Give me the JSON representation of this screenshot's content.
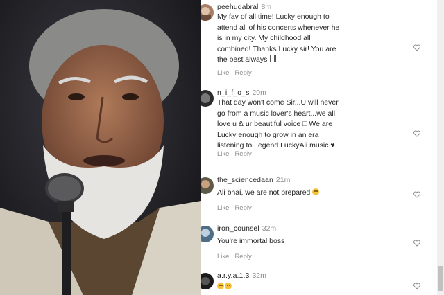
{
  "comments": [
    {
      "username": "peehudabral",
      "time": "8m",
      "text": "My fav of all time! Lucky enough to\nattend all of his concerts whenever he\nis in my city. My childhood all\ncombined! Thanks Lucky sir! You are\nthe best always",
      "like": "Like",
      "reply": "Reply",
      "emoji_suffix": [
        "box",
        "box"
      ]
    },
    {
      "username": "n_i_f_o_s",
      "time": "20m",
      "text": "That day won't come Sir...U will never\ngo from a music lover's heart...we all\nlove u & ur beautiful voice □ We are\nLucky enough to grow in an era\nlistening to Legend LuckyAli music.♥",
      "like": "Like",
      "reply": "Reply"
    },
    {
      "username": "the_sciencedaan",
      "time": "21m",
      "text": "Ali bhai, we are not prepared",
      "like": "Like",
      "reply": "Reply",
      "emoji_suffix": [
        "face"
      ]
    },
    {
      "username": "iron_counsel",
      "time": "32m",
      "text": "You're immortal boss",
      "like": "Like",
      "reply": "Reply"
    },
    {
      "username": "a.r.y.a.1.3",
      "time": "32m",
      "text": "",
      "emoji_suffix": [
        "face",
        "face"
      ]
    }
  ],
  "colors": {
    "text": "#262626",
    "meta": "#8e8e8e",
    "scrollbar": "#c1c1c1"
  },
  "icons": [
    "heart-outline-icon",
    "avatar-image"
  ]
}
